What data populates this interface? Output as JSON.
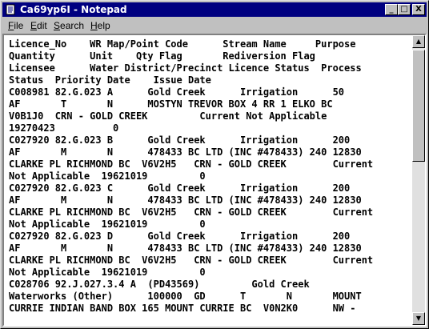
{
  "window": {
    "title": "Ca69yp6I - Notepad"
  },
  "title_buttons": {
    "minimize": "_",
    "maximize": "□",
    "close": "X"
  },
  "menu": [
    {
      "label": "File",
      "accel": "F",
      "rest": "ile"
    },
    {
      "label": "Edit",
      "accel": "E",
      "rest": "dit"
    },
    {
      "label": "Search",
      "accel": "S",
      "rest": "earch"
    },
    {
      "label": "Help",
      "accel": "H",
      "rest": "elp"
    }
  ],
  "content": {
    "lines": [
      "Licence_No    WR Map/Point Code      Stream Name     Purpose",
      "Quantity      Unit    Qty Flag       Rediversion Flag",
      "Licensee      Water District/Precinct Licence Status  Process",
      "Status  Priority Date    Issue Date",
      "C008981 82.G.023 A      Gold Creek      Irrigation      50",
      "AF       T       N      MOSTYN TREVOR BOX 4 RR 1 ELKO BC",
      "V0B1J0  CRN - GOLD CREEK         Current Not Applicable",
      "19270423          0",
      "C027920 82.G.023 B      Gold Creek      Irrigation      200",
      "AF       M       N      478433 BC LTD (INC #478433) 240 12830",
      "CLARKE PL RICHMOND BC  V6V2H5   CRN - GOLD CREEK        Current",
      "Not Applicable  19621019         0",
      "C027920 82.G.023 C      Gold Creek      Irrigation      200",
      "AF       M       N      478433 BC LTD (INC #478433) 240 12830",
      "CLARKE PL RICHMOND BC  V6V2H5   CRN - GOLD CREEK        Current",
      "Not Applicable  19621019         0",
      "C027920 82.G.023 D      Gold Creek      Irrigation      200",
      "AF       M       N      478433 BC LTD (INC #478433) 240 12830",
      "CLARKE PL RICHMOND BC  V6V2H5   CRN - GOLD CREEK        Current",
      "Not Applicable  19621019         0",
      "C028706 92.J.027.3.4 A  (PD43569)         Gold Creek",
      "Waterworks (Other)      100000  GD      T       N       MOUNT",
      "CURRIE INDIAN BAND BOX 165 MOUNT CURRIE BC  V0N2K0      NW -"
    ]
  },
  "scrollbar": {
    "up_arrow": "▲",
    "down_arrow": "▼"
  }
}
